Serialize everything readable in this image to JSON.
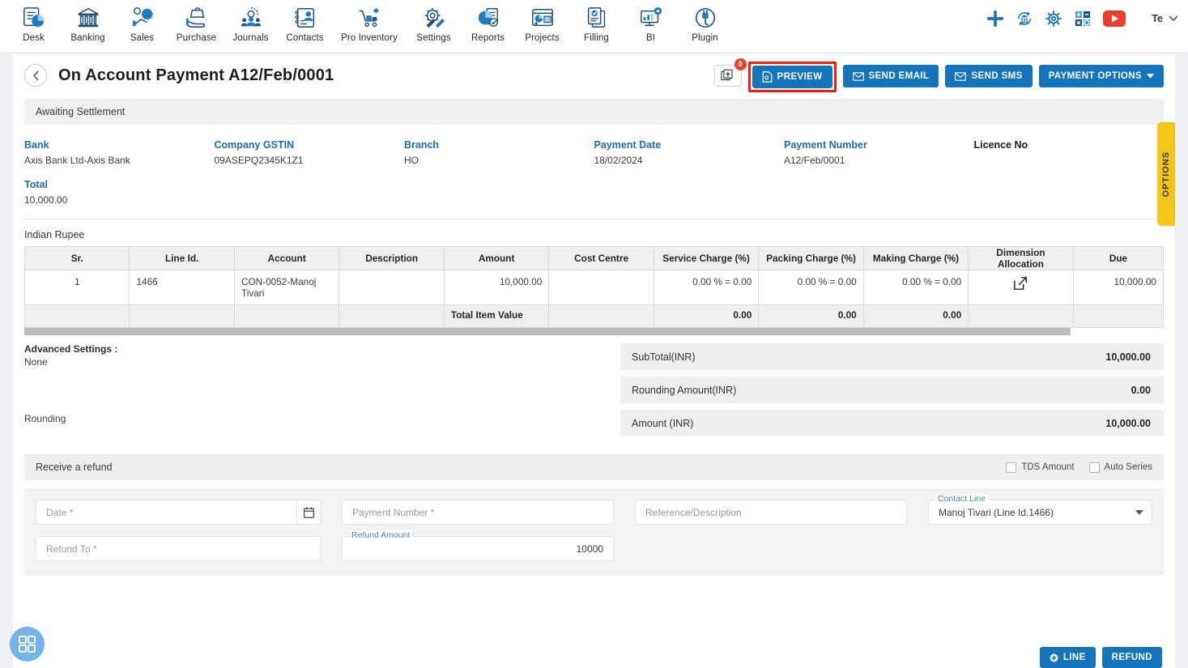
{
  "topnav": {
    "items": [
      {
        "label": "Desk",
        "icon": "desk-dashboard-icon"
      },
      {
        "label": "Banking",
        "icon": "bank-building-icon"
      },
      {
        "label": "Sales",
        "icon": "sales-megaphone-icon"
      },
      {
        "label": "Purchase",
        "icon": "purchase-hand-bag-icon"
      },
      {
        "label": "Journals",
        "icon": "journals-gear-people-icon"
      },
      {
        "label": "Contacts",
        "icon": "contacts-book-icon"
      },
      {
        "label": "Pro Inventory",
        "icon": "inventory-cart-icon"
      },
      {
        "label": "Settings",
        "icon": "settings-gear-tools-icon"
      },
      {
        "label": "Reports",
        "icon": "reports-piechart-icon"
      },
      {
        "label": "Projects",
        "icon": "projects-board-icon"
      },
      {
        "label": "Filling",
        "icon": "filling-documents-icon"
      },
      {
        "label": "BI",
        "icon": "bi-monitor-gear-icon"
      },
      {
        "label": "Plugin",
        "icon": "plugin-plug-icon"
      }
    ],
    "right_icons": [
      {
        "name": "add-plus-icon",
        "color": "#1474bc"
      },
      {
        "name": "refresh-bank-icon",
        "color": "#1474bc"
      },
      {
        "name": "gear-icon",
        "color": "#1474bc"
      },
      {
        "name": "calculator-icon",
        "color": "#1474bc"
      },
      {
        "name": "youtube-icon",
        "color": "#e8402a"
      }
    ],
    "user_label": "Te"
  },
  "header": {
    "back_icon": "chevron-left-icon",
    "title": "On Account Payment A12/Feb/0001",
    "upload_icon": "upload-attachment-icon",
    "upload_badge": "0",
    "buttons": [
      {
        "label": "PREVIEW",
        "icon": "preview-file-icon",
        "highlighted": true
      },
      {
        "label": "SEND EMAIL",
        "icon": "envelope-icon",
        "highlighted": false
      },
      {
        "label": "SEND SMS",
        "icon": "envelope-icon",
        "highlighted": false
      },
      {
        "label": "PAYMENT OPTIONS",
        "icon": "caret-down-icon",
        "highlighted": false
      }
    ],
    "highlight_color": "#f51b0d",
    "accent_color": "#1474bc"
  },
  "status": {
    "text": "Awaiting Settlement"
  },
  "options_tab": {
    "label": "OPTIONS",
    "color": "#f5c518"
  },
  "info": [
    {
      "label": "Bank",
      "value": "Axis Bank Ltd-Axis Bank",
      "dark": false
    },
    {
      "label": "Company GSTIN",
      "value": "09ASEPQ2345K1Z1",
      "dark": false
    },
    {
      "label": "Branch",
      "value": "HO",
      "dark": false
    },
    {
      "label": "Payment Date",
      "value": "18/02/2024",
      "dark": false
    },
    {
      "label": "Payment Number",
      "value": "A12/Feb/0001",
      "dark": false
    },
    {
      "label": "Licence No",
      "value": "",
      "dark": true
    },
    {
      "label": "Total",
      "value": "10,000.00",
      "dark": false
    }
  ],
  "table": {
    "currency_label": "Indian Rupee",
    "columns": [
      "Sr.",
      "Line Id.",
      "Account",
      "Description",
      "Amount",
      "Cost Centre",
      "Service Charge (%)",
      "Packing Charge (%)",
      "Making Charge (%)",
      "Dimension Allocation",
      "Due"
    ],
    "rows": [
      {
        "sr": "1",
        "line_id": "1466",
        "account": "CON-0052-Manoj Tivari",
        "description": "",
        "amount": "10,000.00",
        "cost_centre": "",
        "service_charge": "0.00 % = 0.00",
        "packing_charge": "0.00 % = 0.00",
        "making_charge": "0.00 % = 0.00",
        "dimension_icon": "external-link-icon",
        "due": "10,000.00"
      }
    ],
    "total_row": {
      "label": "Total Item Value",
      "service_charge": "0.00",
      "packing_charge": "0.00",
      "making_charge": "0.00"
    }
  },
  "advanced": {
    "label": "Advanced Settings :",
    "value": "None",
    "rounding_label": "Rounding"
  },
  "totals": [
    {
      "label": "SubTotal(INR)",
      "value": "10,000.00"
    },
    {
      "label": "Rounding Amount(INR)",
      "value": "0.00"
    },
    {
      "label": "Amount (INR)",
      "value": "10,000.00"
    }
  ],
  "refund": {
    "title": "Receive a refund",
    "checkboxes": [
      {
        "label": "TDS Amount",
        "checked": false
      },
      {
        "label": "Auto Series",
        "checked": false
      }
    ],
    "fields": {
      "date_placeholder": "Date *",
      "date_value": "",
      "calendar_icon": "calendar-icon",
      "payment_number_placeholder": "Payment Number *",
      "payment_number_value": "",
      "reference_placeholder": "Reference/Description",
      "reference_value": "",
      "contact_line_label": "Contact Line",
      "contact_line_value": "Manoj Tivari (Line Id.1466)",
      "refund_to_placeholder": "Refund To *",
      "refund_to_value": "",
      "refund_amount_label": "Refund Amount",
      "refund_amount_value": "10000"
    }
  },
  "footer": {
    "buttons": [
      {
        "label": "LINE",
        "icon": "plus-circle-icon"
      },
      {
        "label": "REFUND",
        "icon": ""
      }
    ]
  },
  "fab": {
    "icon": "grid-apps-icon",
    "color": "#74b3e8"
  }
}
